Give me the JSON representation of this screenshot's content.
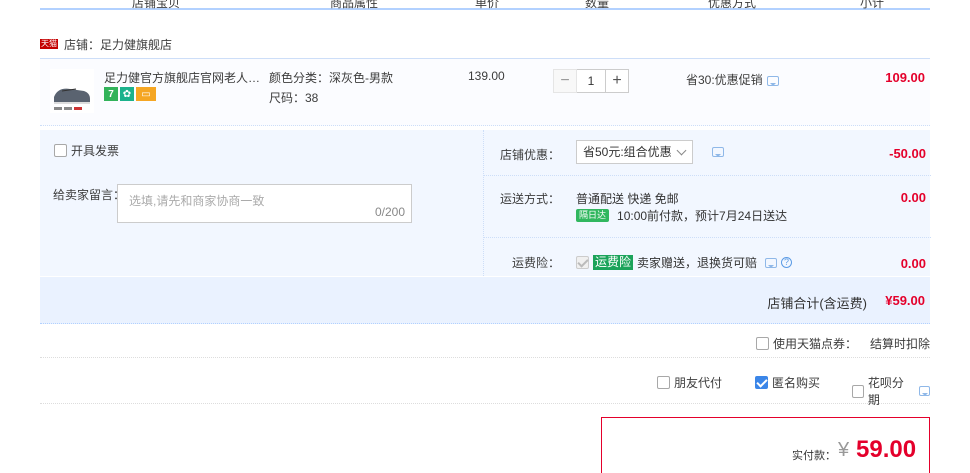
{
  "columns": {
    "item": "店铺宝贝",
    "attrs": "商品属性",
    "price": "单价",
    "qty": "数量",
    "promo": "优惠方式",
    "subtotal": "小计"
  },
  "shop": {
    "badge": "天猫",
    "name": "店铺：足力健旗舰店"
  },
  "item": {
    "title": "足力健官方旗舰店官网老人鞋凉...",
    "svc_icons": [
      "7",
      "✿",
      "▭"
    ],
    "color_attr": "颜色分类：深灰色-男款",
    "size_attr": "尺码：38",
    "unit_price": "139.00",
    "quantity": "1",
    "promo": "省30:优惠促销",
    "subtotal": "109.00"
  },
  "invoice": {
    "label": "开具发票"
  },
  "message": {
    "label": "给卖家留言：",
    "placeholder": "选填,请先和商家协商一致",
    "counter": "0/200"
  },
  "shop_discount": {
    "label": "店铺优惠：",
    "selected": "省50元:组合优惠",
    "amount": "-50.00"
  },
  "shipping": {
    "label": "运送方式：",
    "method": "普通配送 快递 免邮",
    "badge": "隔日达",
    "eta": "10:00前付款，预计7月24日送达",
    "amount": "0.00"
  },
  "insurance": {
    "label": "运费险：",
    "badge": "运费险",
    "text": "卖家赠送，退换货可赔",
    "help": "?",
    "amount": "0.00"
  },
  "shop_total": {
    "label": "店铺合计(含运费)",
    "amount": "¥59.00"
  },
  "coupon": {
    "label": "使用天猫点券：",
    "note": "结算时扣除"
  },
  "pay_options": {
    "friend_pay": "朋友代付",
    "anonymous": "匿名购买",
    "huabei": "花呗分期"
  },
  "final": {
    "label": "实付款：",
    "currency": "¥",
    "amount": "59.00"
  },
  "colors": {
    "accent_red": "#e4002b",
    "accent_blue": "#3b86e8",
    "panel_bg": "#f2f7ff"
  }
}
